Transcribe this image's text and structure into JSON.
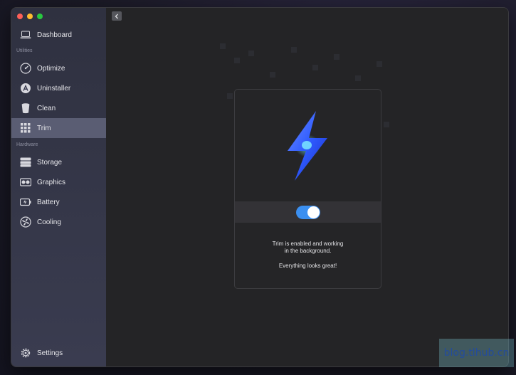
{
  "sidebar": {
    "sections": {
      "utilities": "Utilities",
      "hardware": "Hardware"
    },
    "items": [
      {
        "label": "Dashboard",
        "icon": "laptop-icon",
        "active": false
      },
      {
        "label": "Optimize",
        "icon": "gauge-icon",
        "active": false
      },
      {
        "label": "Uninstaller",
        "icon": "app-store-icon",
        "active": false
      },
      {
        "label": "Clean",
        "icon": "trash-icon",
        "active": false
      },
      {
        "label": "Trim",
        "icon": "grid-icon",
        "active": true
      },
      {
        "label": "Storage",
        "icon": "storage-icon",
        "active": false
      },
      {
        "label": "Graphics",
        "icon": "graphics-card-icon",
        "active": false
      },
      {
        "label": "Battery",
        "icon": "battery-icon",
        "active": false
      },
      {
        "label": "Cooling",
        "icon": "fan-icon",
        "active": false
      },
      {
        "label": "Settings",
        "icon": "gear-icon",
        "active": false
      }
    ]
  },
  "card": {
    "icon": "lightning-icon",
    "toggle_on": true,
    "message_line1": "Trim is enabled and working",
    "message_line2": "in the background.",
    "message_line3": "Everything looks great!"
  },
  "watermark": "blog.tlhub.cn",
  "colors": {
    "accent": "#3b8ff0",
    "active_item": "#5a5d73",
    "sidebar_bg": "#33354a"
  }
}
